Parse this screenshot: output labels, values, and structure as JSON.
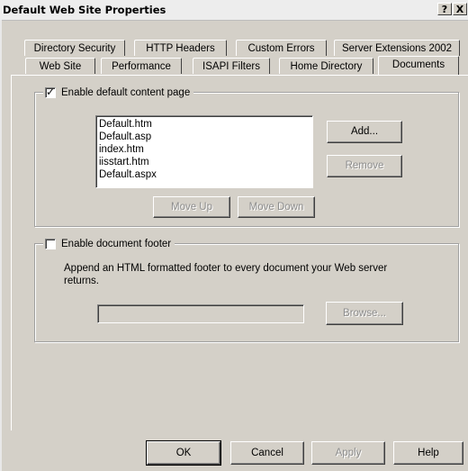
{
  "window": {
    "title": "Default Web Site Properties",
    "help_label": "?",
    "close_label": "X"
  },
  "tabs": {
    "row_back": [
      {
        "label": "Directory Security"
      },
      {
        "label": "HTTP Headers"
      },
      {
        "label": "Custom Errors"
      },
      {
        "label": "Server Extensions 2002"
      }
    ],
    "row_front": [
      {
        "label": "Web Site"
      },
      {
        "label": "Performance"
      },
      {
        "label": "ISAPI Filters"
      },
      {
        "label": "Home Directory"
      },
      {
        "label": "Documents",
        "active": true
      }
    ]
  },
  "default_content": {
    "checkbox_label": "Enable default content page",
    "checked": true,
    "documents": [
      "Default.htm",
      "Default.asp",
      "index.htm",
      "iisstart.htm",
      "Default.aspx"
    ],
    "add_label": "Add...",
    "remove_label": "Remove",
    "move_up_label": "Move Up",
    "move_down_label": "Move Down"
  },
  "footer": {
    "checkbox_label": "Enable document footer",
    "checked": false,
    "description": "Append an HTML formatted footer to every document your Web server returns.",
    "path_value": "",
    "browse_label": "Browse..."
  },
  "bottom_buttons": {
    "ok_label": "OK",
    "cancel_label": "Cancel",
    "apply_label": "Apply",
    "help_label": "Help"
  }
}
